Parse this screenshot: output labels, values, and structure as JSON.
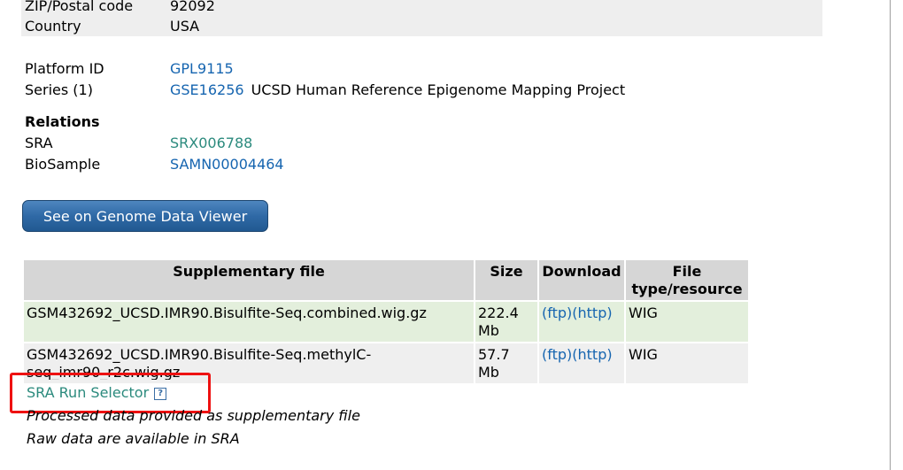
{
  "contact": {
    "zip_label": "ZIP/Postal code",
    "zip_value": "92092",
    "country_label": "Country",
    "country_value": "USA"
  },
  "platform": {
    "label": "Platform ID",
    "id": "GPL9115"
  },
  "series": {
    "label": "Series (1)",
    "id": "GSE16256",
    "title": "UCSD Human Reference Epigenome Mapping Project"
  },
  "relations": {
    "heading": "Relations",
    "sra_label": "SRA",
    "sra_id": "SRX006788",
    "biosample_label": "BioSample",
    "biosample_id": "SAMN00004464"
  },
  "genome_viewer_button": "See on Genome Data Viewer",
  "supplementary_table": {
    "headers": {
      "file": "Supplementary file",
      "size": "Size",
      "download": "Download",
      "type": "File type/resource"
    },
    "rows": [
      {
        "file": "GSM432692_UCSD.IMR90.Bisulfite-Seq.combined.wig.gz",
        "size": "222.4 Mb",
        "ftp": "(ftp)",
        "http": "(http)",
        "type": "WIG"
      },
      {
        "file": "GSM432692_UCSD.IMR90.Bisulfite-Seq.methylC-seq_imr90_r2c.wig.gz",
        "size": "57.7 Mb",
        "ftp": "(ftp)",
        "http": "(http)",
        "type": "WIG"
      }
    ]
  },
  "sra_run_selector": {
    "label": "SRA Run Selector",
    "help_icon_glyph": "?"
  },
  "notes": {
    "processed": "Processed data provided as supplementary file",
    "raw": "Raw data are available in SRA"
  },
  "colors": {
    "link": "#1665b0",
    "sra_link": "#2b8a7d",
    "button": "#2f69a6",
    "highlight": "#ee1111"
  }
}
